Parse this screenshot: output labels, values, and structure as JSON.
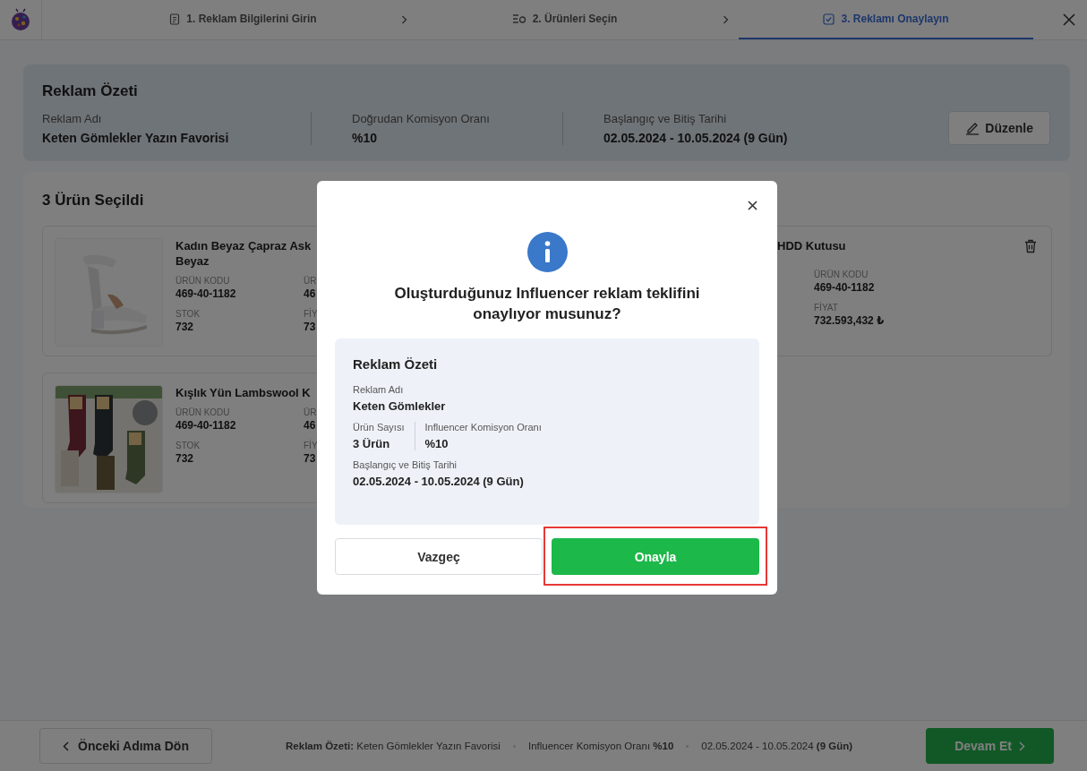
{
  "steps": [
    {
      "label": "1. Reklam Bilgilerini Girin",
      "selected": false
    },
    {
      "label": "2. Ürünleri Seçin",
      "selected": false
    },
    {
      "label": "3. Reklamı Onaylayın",
      "selected": true
    }
  ],
  "summary": {
    "title": "Reklam Özeti",
    "fields": [
      {
        "label": "Reklam Adı",
        "value": "Keten Gömlekler Yazın Favorisi"
      },
      {
        "label": "Doğrudan Komisyon Oranı",
        "value": "%10"
      },
      {
        "label": "Başlangıç ve Bitiş Tarihi",
        "value": "02.05.2024 - 10.05.2024 (9 Gün)"
      }
    ],
    "edit_button": "Düzenle"
  },
  "products": {
    "title": "3 Ürün Seçildi",
    "left": [
      {
        "name_lines": [
          "Kadın Beyaz Çapraz Ask",
          "Beyaz"
        ],
        "fields": [
          {
            "label": "ÜRÜN KODU",
            "value": "469-40-1182"
          },
          {
            "label": "ÜR",
            "value": "46"
          },
          {
            "label": "STOK",
            "value": "732"
          },
          {
            "label": "FİY",
            "value": "73"
          }
        ]
      },
      {
        "name_lines": [
          "Kışlık Yün Lambswool K"
        ],
        "fields": [
          {
            "label": "ÜRÜN KODU",
            "value": "469-40-1182"
          },
          {
            "label": "ÜR",
            "value": "46"
          },
          {
            "label": "STOK",
            "value": "732"
          },
          {
            "label": "FİY",
            "value": "73"
          }
        ]
      }
    ],
    "right": [
      {
        "name_lines": [
          "HDD Kutusu"
        ],
        "fields": [
          {
            "label": "ÜRÜN KODU",
            "value": "469-40-1182"
          },
          {
            "label": "FİYAT",
            "value": "732.593,432 ₺"
          }
        ]
      }
    ]
  },
  "modal": {
    "title": "Oluşturduğunuz Influencer reklam teklifini onaylıyor musunuz?",
    "box_title": "Reklam Özeti",
    "rows": [
      [
        {
          "label": "Reklam Adı",
          "value": "Keten Gömlekler"
        }
      ],
      [
        {
          "label": "Ürün Sayısı",
          "value": "3 Ürün"
        },
        {
          "label": "Influencer Komisyon Oranı",
          "value": "%10"
        }
      ],
      [
        {
          "label": "Başlangıç ve Bitiş Tarihi",
          "value": "02.05.2024 - 10.05.2024 (9 Gün)"
        }
      ]
    ],
    "cancel": "Vazgeç",
    "confirm": "Onayla",
    "confirm_highlighted": true
  },
  "footer": {
    "back": "Önceki Adıma Dön",
    "info": [
      "**Reklam Özeti:** Keten Gömlekler Yazın Favorisi",
      "Influencer Komisyon Oranı **%10**",
      "02.05.2024 - 10.05.2024 **(9 Gün)**"
    ],
    "next": "Devam Et"
  }
}
